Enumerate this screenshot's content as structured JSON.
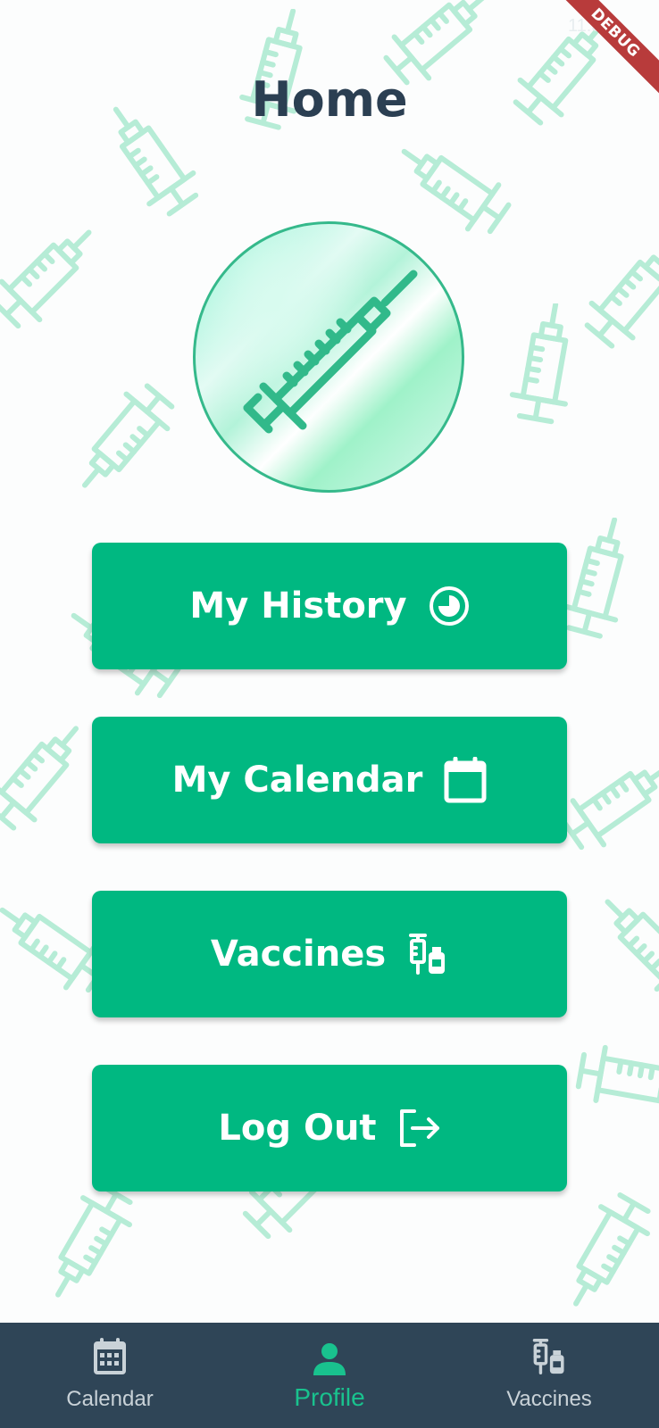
{
  "status": {
    "time": "11:3"
  },
  "debug_banner": "DEBUG",
  "header": {
    "title": "Home"
  },
  "logo": {
    "icon": "syringe-icon"
  },
  "menu": {
    "history": {
      "label": "My History",
      "icon": "history-clock-icon"
    },
    "calendar": {
      "label": "My Calendar",
      "icon": "calendar-icon"
    },
    "vaccines": {
      "label": "Vaccines",
      "icon": "vaccine-vials-icon"
    },
    "logout": {
      "label": "Log Out",
      "icon": "logout-icon"
    }
  },
  "bottom_nav": {
    "calendar": {
      "label": "Calendar",
      "icon": "calendar-grid-icon"
    },
    "profile": {
      "label": "Profile",
      "icon": "person-icon",
      "active": true
    },
    "vaccines": {
      "label": "Vaccines",
      "icon": "vaccine-vials-icon"
    }
  },
  "colors": {
    "accent": "#00b881",
    "title": "#2b3f52",
    "nav_bg": "#2f4557",
    "nav_active": "#19c28e",
    "pattern": "#b6ecd6"
  }
}
